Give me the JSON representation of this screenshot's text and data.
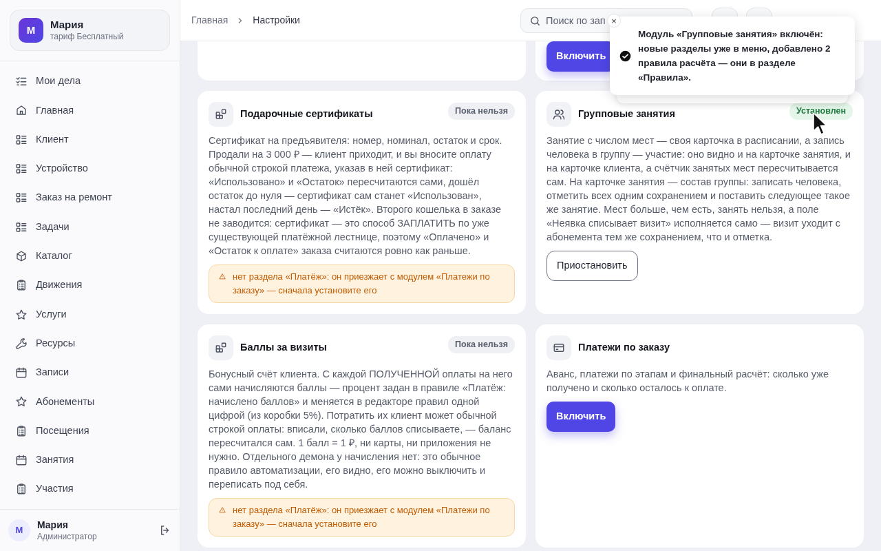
{
  "profile": {
    "avatar": "М",
    "name": "Мария",
    "plan": "тариф Бесплатный"
  },
  "sidebar": {
    "items": [
      {
        "label": "Мои дела",
        "kind": "checklist"
      },
      {
        "label": "Главная",
        "kind": "home"
      },
      {
        "label": "Клиент",
        "kind": "list"
      },
      {
        "label": "Устройство",
        "kind": "list"
      },
      {
        "label": "Заказ на ремонт",
        "kind": "list"
      },
      {
        "label": "Задачи",
        "kind": "list"
      },
      {
        "label": "Каталог",
        "kind": "box"
      },
      {
        "label": "Движения",
        "kind": "clipboard"
      },
      {
        "label": "Услуги",
        "kind": "star"
      },
      {
        "label": "Ресурсы",
        "kind": "wrench"
      },
      {
        "label": "Записи",
        "kind": "calendar"
      },
      {
        "label": "Абонементы",
        "kind": "star"
      },
      {
        "label": "Посещения",
        "kind": "clipboard"
      },
      {
        "label": "Занятия",
        "kind": "calendar"
      },
      {
        "label": "Участия",
        "kind": "clipboard"
      }
    ]
  },
  "user": {
    "avatar": "М",
    "name": "Мария",
    "role": "Администратор"
  },
  "breadcrumb": [
    "Главная",
    "Настройки"
  ],
  "search": {
    "placeholder": "Поиск по зап"
  },
  "top_row": [
    {
      "kind": "empty"
    },
    {
      "kind": "action",
      "button": {
        "label": "Включить",
        "kind": "primary"
      }
    }
  ],
  "modules": [
    {
      "title": "Подарочные сертификаты",
      "kind": "blocks",
      "status": {
        "text": "Пока нельзя",
        "kind": "blocked"
      },
      "description": "Сертификат на предъявителя: номер, номинал, остаток и срок. Продали на 3 000 ₽ — клиент приходит, и вы вносите оплату обычной строкой платежа, указав в ней сертификат: «Использовано» и «Остаток» пересчитаются сами, дошёл остаток до нуля — сертификат сам станет «Использован», настал последний день — «Истёк». Второго кошелька в заказе не заводится: сертификат — это способ ЗАПЛАТИТЬ по уже существующей платёжной лестнице, поэтому «Оплачено» и «Остаток к оплате» заказа считаются ровно как раньше.",
      "warning": "нет раздела «Платёж»: он приезжает с модулем «Платежи по заказу» — сначала установите его"
    },
    {
      "title": "Групповые занятия",
      "kind": "people",
      "status": {
        "text": "Установлен",
        "kind": "installed"
      },
      "description": "Занятие с числом мест — своя карточка в расписании, а запись человека в группу — участие: оно видно и на карточке занятия, и на карточке клиента, а счётчик занятых мест пересчитывается сам. На карточке занятия — состав группы: записать человека, отметить всех одним сохранением и поставить следующее такое же занятие. Мест больше, чем есть, занять нельзя, а поле «Неявка списывает визит» исполняется само — визит уходит с абонемента тем же сохранением, что и отметка.",
      "button": {
        "label": "Приостановить",
        "kind": "outline"
      }
    },
    {
      "title": "Баллы за визиты",
      "kind": "blocks",
      "status": {
        "text": "Пока нельзя",
        "kind": "blocked"
      },
      "description": "Бонусный счёт клиента. С каждой ПОЛУЧЕННОЙ оплаты на него сами начисляются баллы — процент задан в правиле «Платёж: начислено баллов» и меняется в редакторе правил одной цифрой (из коробки 5%). Потратить их клиент может обычной строкой оплаты: вписали, сколько баллов списываете, — баланс пересчитался сам. 1 балл = 1 ₽, ни карты, ни приложения не нужно. Отдельного демона у начисления нет: это обычное правило автоматизации, его видно, его можно выключить и переписать под себя.",
      "warning": "нет раздела «Платёж»: он приезжает с модулем «Платежи по заказу» — сначала установите его"
    },
    {
      "title": "Платежи по заказу",
      "kind": "card",
      "description": "Аванс, платежи по этапам и финальный расчёт: сколько уже получено и сколько осталось к оплате.",
      "button": {
        "label": "Включить",
        "kind": "primary"
      }
    }
  ],
  "toast": {
    "close": "×",
    "message": "Модуль «Групповые занятия» включён: новые разделы уже в меню, добавлено 2 правила расчёта — они в разделе «Правила»."
  }
}
